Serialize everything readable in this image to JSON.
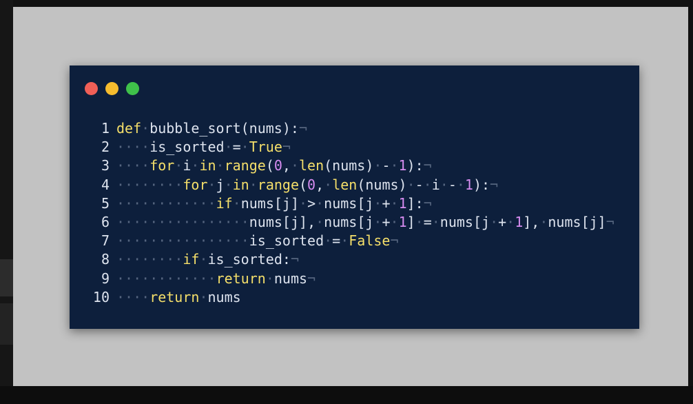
{
  "window": {
    "controls": [
      "close",
      "minimize",
      "maximize"
    ],
    "colors": {
      "background": "#0d1f3c",
      "red": "#f05f57",
      "yellow": "#f6bc2e",
      "green": "#3fc14a"
    }
  },
  "code": {
    "language": "python",
    "lines": [
      {
        "num": "1",
        "text": "def bubble_sort(nums):"
      },
      {
        "num": "2",
        "text": "    is_sorted = True"
      },
      {
        "num": "3",
        "text": "    for i in range(0, len(nums) - 1):"
      },
      {
        "num": "4",
        "text": "        for j in range(0, len(nums) - i - 1):"
      },
      {
        "num": "5",
        "text": "            if nums[j] > nums[j + 1]:"
      },
      {
        "num": "6",
        "text": "                nums[j], nums[j + 1] = nums[j + 1], nums[j]"
      },
      {
        "num": "7",
        "text": "                is_sorted = False"
      },
      {
        "num": "8",
        "text": "        if is_sorted:"
      },
      {
        "num": "9",
        "text": "            return nums"
      },
      {
        "num": "10",
        "text": "    return nums"
      }
    ],
    "colors": {
      "text": "#dde3ee",
      "keyword": "#f5df6a",
      "number": "#d68cf0",
      "whitespace_marker": "#55657f"
    }
  }
}
